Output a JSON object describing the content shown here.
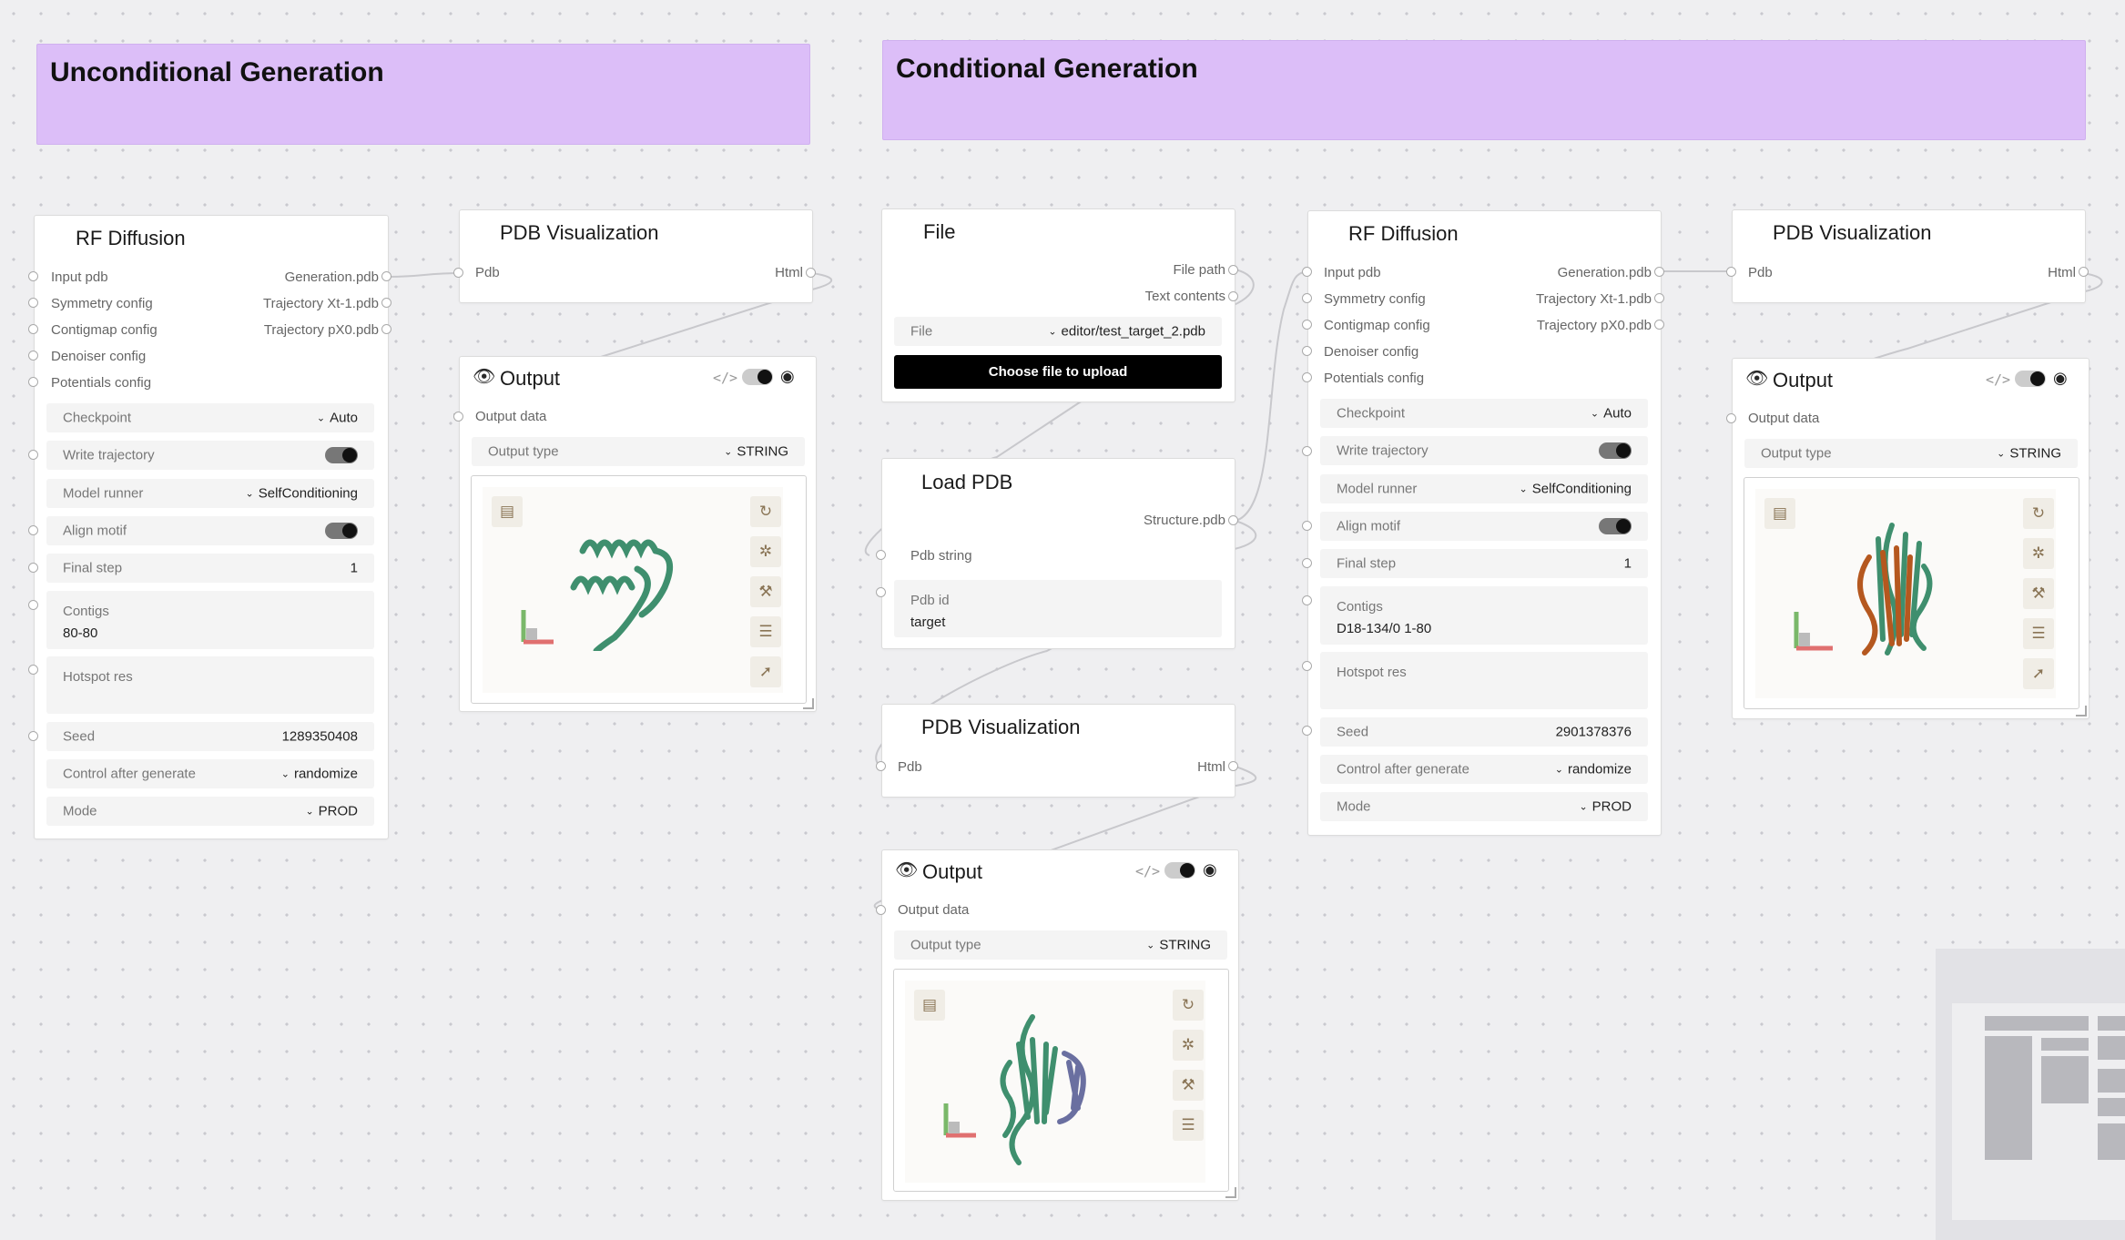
{
  "groups": {
    "unconditional": "Unconditional Generation",
    "conditional": "Conditional Generation"
  },
  "rf1": {
    "title": "RF Diffusion",
    "inputs": [
      "Input pdb",
      "Symmetry config",
      "Contigmap config",
      "Denoiser config",
      "Potentials config"
    ],
    "outputs": [
      "Generation.pdb",
      "Trajectory Xt-1.pdb",
      "Trajectory pX0.pdb"
    ],
    "checkpoint_label": "Checkpoint",
    "checkpoint_value": "Auto",
    "write_traj_label": "Write trajectory",
    "model_runner_label": "Model runner",
    "model_runner_value": "SelfConditioning",
    "align_motif_label": "Align motif",
    "final_step_label": "Final step",
    "final_step_value": "1",
    "contigs_label": "Contigs",
    "contigs_value": "80-80",
    "hotspot_label": "Hotspot res",
    "seed_label": "Seed",
    "seed_value": "1289350408",
    "control_label": "Control after generate",
    "control_value": "randomize",
    "mode_label": "Mode",
    "mode_value": "PROD"
  },
  "vis1": {
    "title": "PDB Visualization",
    "in": "Pdb",
    "out": "Html"
  },
  "out1": {
    "title": "Output",
    "data_label": "Output data",
    "type_label": "Output type",
    "type_value": "STRING"
  },
  "file": {
    "title": "File",
    "out1": "File path",
    "out2": "Text contents",
    "file_label": "File",
    "file_value": "editor/test_target_2.pdb",
    "button": "Choose file to upload"
  },
  "load": {
    "title": "Load PDB",
    "out": "Structure.pdb",
    "in": "Pdb string",
    "pdbid_label": "Pdb id",
    "pdbid_value": "target"
  },
  "vis2": {
    "title": "PDB Visualization",
    "in": "Pdb",
    "out": "Html"
  },
  "out2": {
    "title": "Output",
    "data_label": "Output data",
    "type_label": "Output type",
    "type_value": "STRING"
  },
  "rf2": {
    "title": "RF Diffusion",
    "inputs": [
      "Input pdb",
      "Symmetry config",
      "Contigmap config",
      "Denoiser config",
      "Potentials config"
    ],
    "outputs": [
      "Generation.pdb",
      "Trajectory Xt-1.pdb",
      "Trajectory pX0.pdb"
    ],
    "checkpoint_label": "Checkpoint",
    "checkpoint_value": "Auto",
    "write_traj_label": "Write trajectory",
    "model_runner_label": "Model runner",
    "model_runner_value": "SelfConditioning",
    "align_motif_label": "Align motif",
    "final_step_label": "Final step",
    "final_step_value": "1",
    "contigs_label": "Contigs",
    "contigs_value": "D18-134/0 1-80",
    "hotspot_label": "Hotspot res",
    "seed_label": "Seed",
    "seed_value": "2901378376",
    "control_label": "Control after generate",
    "control_value": "randomize",
    "mode_label": "Mode",
    "mode_value": "PROD"
  },
  "vis3": {
    "title": "PDB Visualization",
    "in": "Pdb",
    "out": "Html"
  },
  "out3": {
    "title": "Output",
    "data_label": "Output data",
    "type_label": "Output type",
    "type_value": "STRING"
  },
  "colors": {
    "group_bg": "#dcbef8",
    "protein_green": "#3f8f6e",
    "protein_orange": "#b5581f",
    "protein_purple": "#6a6fa0",
    "toggle_on": "#111111"
  },
  "icons": [
    "eye-icon",
    "code-icon",
    "refresh-icon",
    "settings-icon",
    "wrench-icon",
    "sliders-icon",
    "cursor-icon",
    "screenshot-icon"
  ]
}
